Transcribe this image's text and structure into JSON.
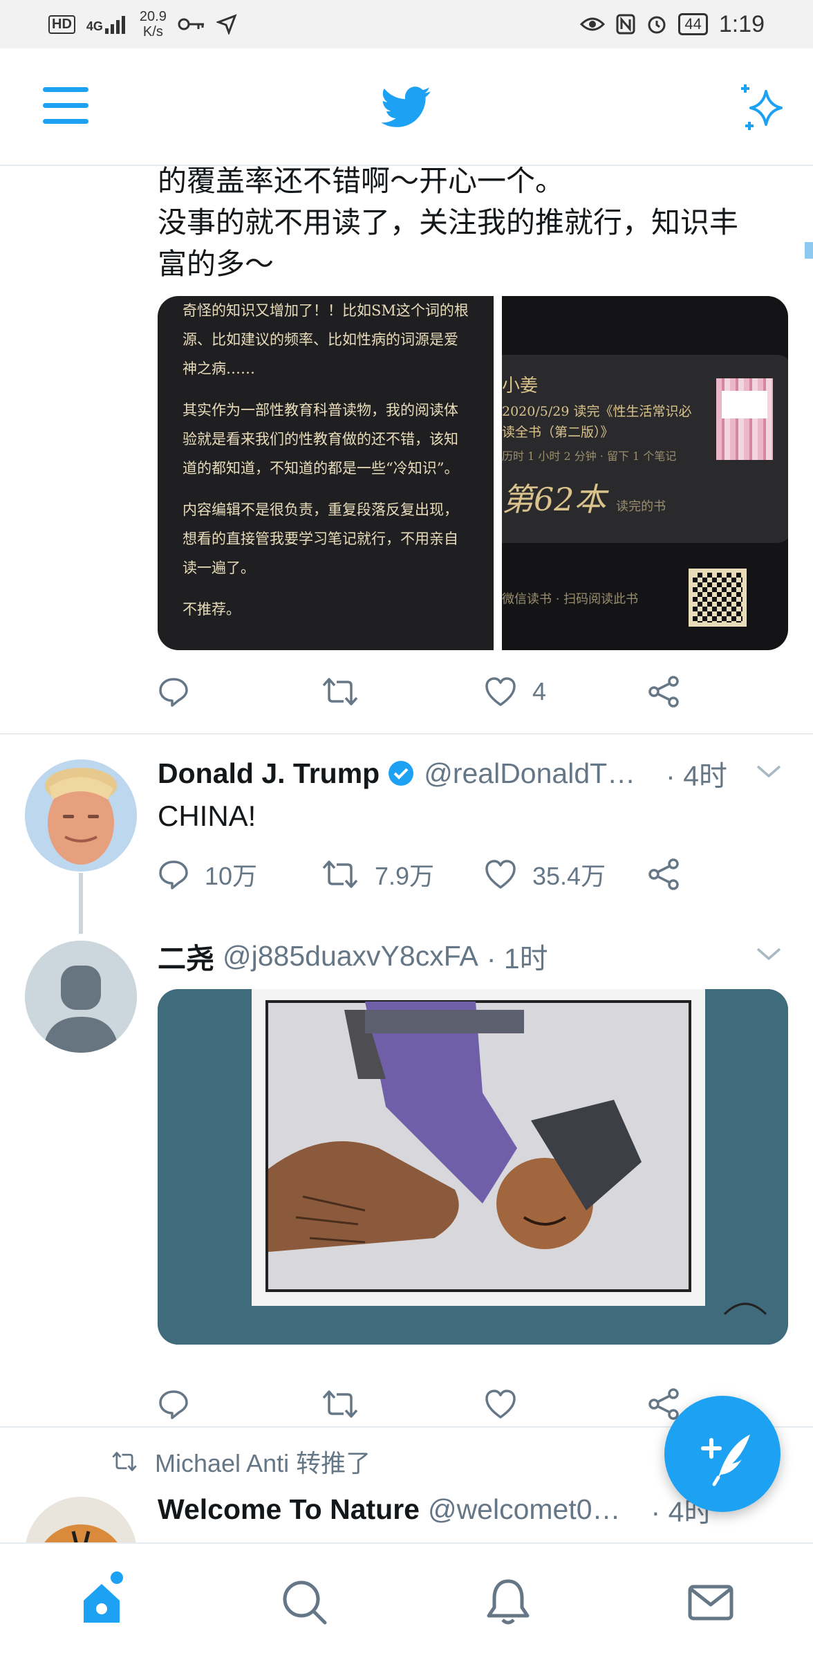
{
  "status_bar": {
    "network_badge": "HD",
    "signal_type": "4G",
    "speed_value": "20.9",
    "speed_unit": "K/s",
    "battery": "44",
    "time": "1:19"
  },
  "top_bar": {
    "menu_icon": "hamburger-menu-icon",
    "logo_icon": "twitter-bird-icon",
    "sparkle_icon": "sparkle-icon"
  },
  "tweets": [
    {
      "text_lines": [
        "的覆盖率还不错啊～开心一个。",
        "没事的就不用读了，关注我的推就行，知识丰",
        "富的多～"
      ],
      "media_left": {
        "paragraphs": [
          "奇怪的知识又增加了！！比如SM这个词的根源、比如建议的频率、比如性病的词源是爱神之病……",
          "其实作为一部性教育科普读物，我的阅读体验就是看来我们的性教育做的还不错，该知道的都知道，不知道的都是一些“冷知识”。",
          "内容编辑不是很负责，重复段落反复出现，想看的直接管我要学习笔记就行，不用亲自读一遍了。",
          "不推荐。"
        ]
      },
      "media_right": {
        "name": "小姜",
        "line1": "2020/5/29 读完《性生活常识必",
        "line2": "读全书（第二版）》",
        "stats": "历时 1 小时 2 分钟 · 留下 1 个笔记",
        "count": "第62本",
        "count_suffix": "读完的书",
        "footer": "微信读书 · 扫码阅读此书"
      },
      "actions": {
        "reply": "",
        "retweet": "",
        "like": "4"
      }
    },
    {
      "name": "Donald J. Trump",
      "handle": "@realDonaldT…",
      "time": "· 4时",
      "text": "CHINA!",
      "actions": {
        "reply": "10万",
        "retweet": "7.9万",
        "like": "35.4万"
      }
    },
    {
      "name": "二尧",
      "handle": "@j885duaxvY8cxFA",
      "time": "· 1时",
      "actions": {
        "reply": "",
        "retweet": "",
        "like": ""
      }
    },
    {
      "retweeted_by": "Michael Anti 转推了",
      "name": "Welcome To Nature",
      "handle": "@welcomet0…",
      "time": "· 4时"
    }
  ],
  "colors": {
    "accent": "#1da1f2",
    "text_primary": "#14171a",
    "text_secondary": "#657786",
    "divider": "#e6ecf0"
  },
  "bottom_nav": {
    "items": [
      "home-icon",
      "search-icon",
      "notifications-icon",
      "messages-icon"
    ],
    "active": "home-icon"
  },
  "fab": {
    "icon": "compose-tweet-icon"
  }
}
